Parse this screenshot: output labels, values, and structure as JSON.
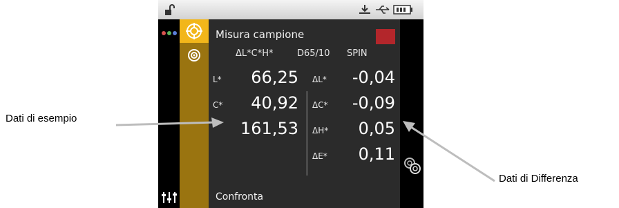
{
  "callouts": {
    "sample_data": "Dati di esempio",
    "difference_data": "Dati di Differenza"
  },
  "screen": {
    "title": "Misura campione",
    "header": {
      "color_space": "ΔL*C*H*",
      "illuminant": "D65/10",
      "mode": "SPIN"
    },
    "sample": [
      {
        "label": "L*",
        "value": "66,25"
      },
      {
        "label": "C*",
        "value": "40,92"
      },
      {
        "label": "",
        "value": "161,53"
      }
    ],
    "difference": [
      {
        "label": "ΔL*",
        "value": "-0,04"
      },
      {
        "label": "ΔC*",
        "value": "-0,09"
      },
      {
        "label": "ΔH*",
        "value": "0,05"
      },
      {
        "label": "ΔE*",
        "value": "0,11"
      }
    ],
    "footer": "Confronta",
    "swatch_color": "#b3262b"
  },
  "icons": [
    "lock-open-icon",
    "dots-menu-icon",
    "target-icon",
    "measure-mode-icon",
    "settings-sliders-icon",
    "download-icon",
    "usb-icon",
    "battery-icon",
    "compare-targets-icon"
  ]
}
